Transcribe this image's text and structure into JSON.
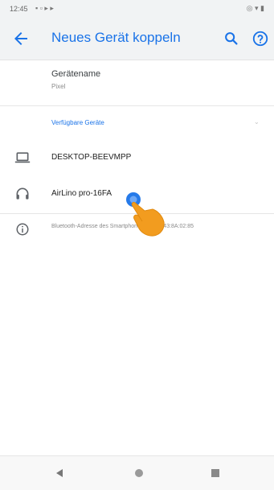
{
  "status_bar": {
    "time": "12:45",
    "notification_glyphs": "▪ ▫ ▸ ▸",
    "right_glyphs": "◎ ▾ ▮"
  },
  "app_bar": {
    "title": "Neues Gerät koppeln",
    "back_icon": "arrow-back-icon",
    "search_icon": "search-icon",
    "help_icon": "help-icon"
  },
  "device_name": {
    "label": "Gerätename",
    "value": "Pixel"
  },
  "available_devices": {
    "header": "Verfügbare Geräte",
    "chevron": "⌄",
    "items": [
      {
        "icon": "laptop-icon",
        "label": "DESKTOP-BEEVMPP"
      },
      {
        "icon": "headphones-icon",
        "label": "AirLino pro-16FA"
      }
    ]
  },
  "info": {
    "icon": "info-icon",
    "text": "Bluetooth-Adresse des Smartphones: AC:37:43:8A:02:85"
  },
  "nav_bar": {
    "back_icon": "nav-back-icon",
    "home_icon": "nav-home-icon",
    "recent_icon": "nav-recent-icon"
  },
  "colors": {
    "accent": "#1a73e8",
    "bar_background": "#f1f3f4",
    "tap_hand": "#f29c1f"
  }
}
